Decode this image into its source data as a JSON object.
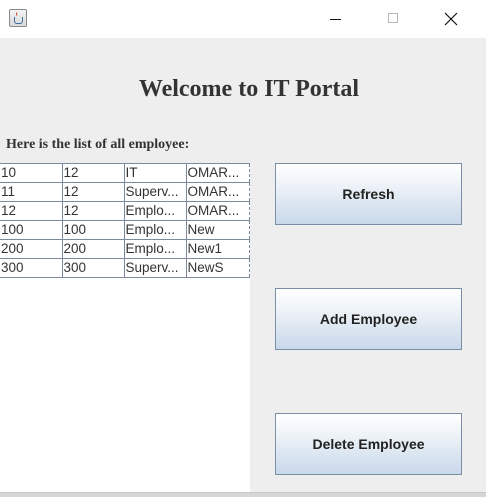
{
  "window": {
    "title": "",
    "icon": "java-cup-icon"
  },
  "header": {
    "title": "Welcome to IT Portal",
    "list_label": "Here is the list of all employee:"
  },
  "table": {
    "rows": [
      [
        "10",
        "12",
        "IT",
        "OMAR..."
      ],
      [
        "11",
        "12",
        "Superv...",
        "OMAR..."
      ],
      [
        "12",
        "12",
        "Emplo...",
        "OMAR..."
      ],
      [
        "100",
        "100",
        "Emplo...",
        "New"
      ],
      [
        "200",
        "200",
        "Emplo...",
        "New1"
      ],
      [
        "300",
        "300",
        "Superv...",
        "NewS"
      ]
    ]
  },
  "buttons": {
    "refresh": "Refresh",
    "add": "Add Employee",
    "delete": "Delete Employee"
  }
}
